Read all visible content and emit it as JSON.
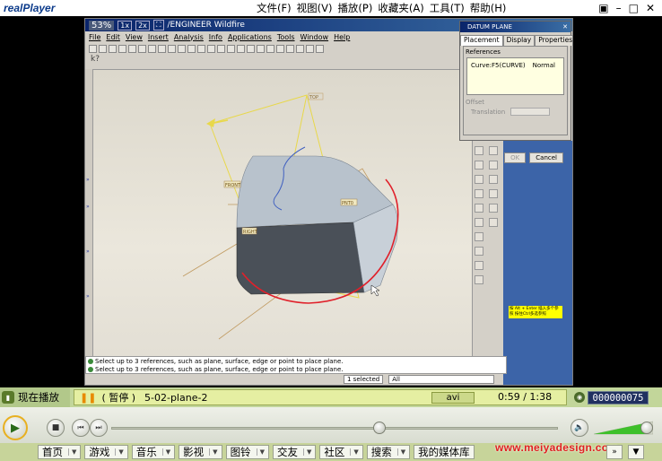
{
  "app": {
    "logo": "realPlayer",
    "menu": [
      "文件(F)",
      "视图(V)",
      "播放(P)",
      "收藏夹(A)",
      "工具(T)",
      "帮助(H)"
    ]
  },
  "proe": {
    "zoom": "53%",
    "zoom_1x": "1x",
    "zoom_2x": "2x",
    "title": "/ENGINEER Wildfire",
    "menu": [
      "File",
      "Edit",
      "View",
      "Insert",
      "Analysis",
      "Info",
      "Applications",
      "Tools",
      "Window",
      "Help"
    ],
    "messages": [
      "Select up to 3 references, such as plane, surface, edge or point to place plane.",
      "Select up to 3 references, such as plane, surface, edge or point to place plane."
    ],
    "status_selected": "1 selected",
    "status_filter": "All",
    "hint_text": "按 Alt + Enter 插入多个参照 按住Ctrl多选参照",
    "datum_dialog": {
      "title": "DATUM PLANE",
      "tabs": [
        "Placement",
        "Display",
        "Properties"
      ],
      "references_label": "References",
      "reference": "Curve:F5(CURVE)",
      "constraint": "Normal",
      "offset_label": "Offset",
      "translation_label": "Translation",
      "ok": "OK",
      "cancel": "Cancel"
    },
    "model_labels": [
      "TOP",
      "FRONT",
      "RIGHT",
      "PNT0"
    ]
  },
  "player": {
    "now_playing_tab": "现在播放",
    "state": "( 暂停 )",
    "clip_name": "5-02-plane-2",
    "codec": "avi",
    "time": "0:59 / 1:38",
    "counter": "000000075",
    "seek_progress": 0.6,
    "volume_level": 0.9
  },
  "nav": [
    "首页",
    "游戏",
    "音乐",
    "影视",
    "图铃",
    "交友",
    "社区",
    "搜索",
    "我的媒体库"
  ],
  "watermark": "www.meiyadesign.com",
  "colors": {
    "player_green": "#c2d69a",
    "status_yellow": "#e5efa2",
    "curve_red": "#e0202a",
    "datum_yellow": "#e8d84a"
  }
}
